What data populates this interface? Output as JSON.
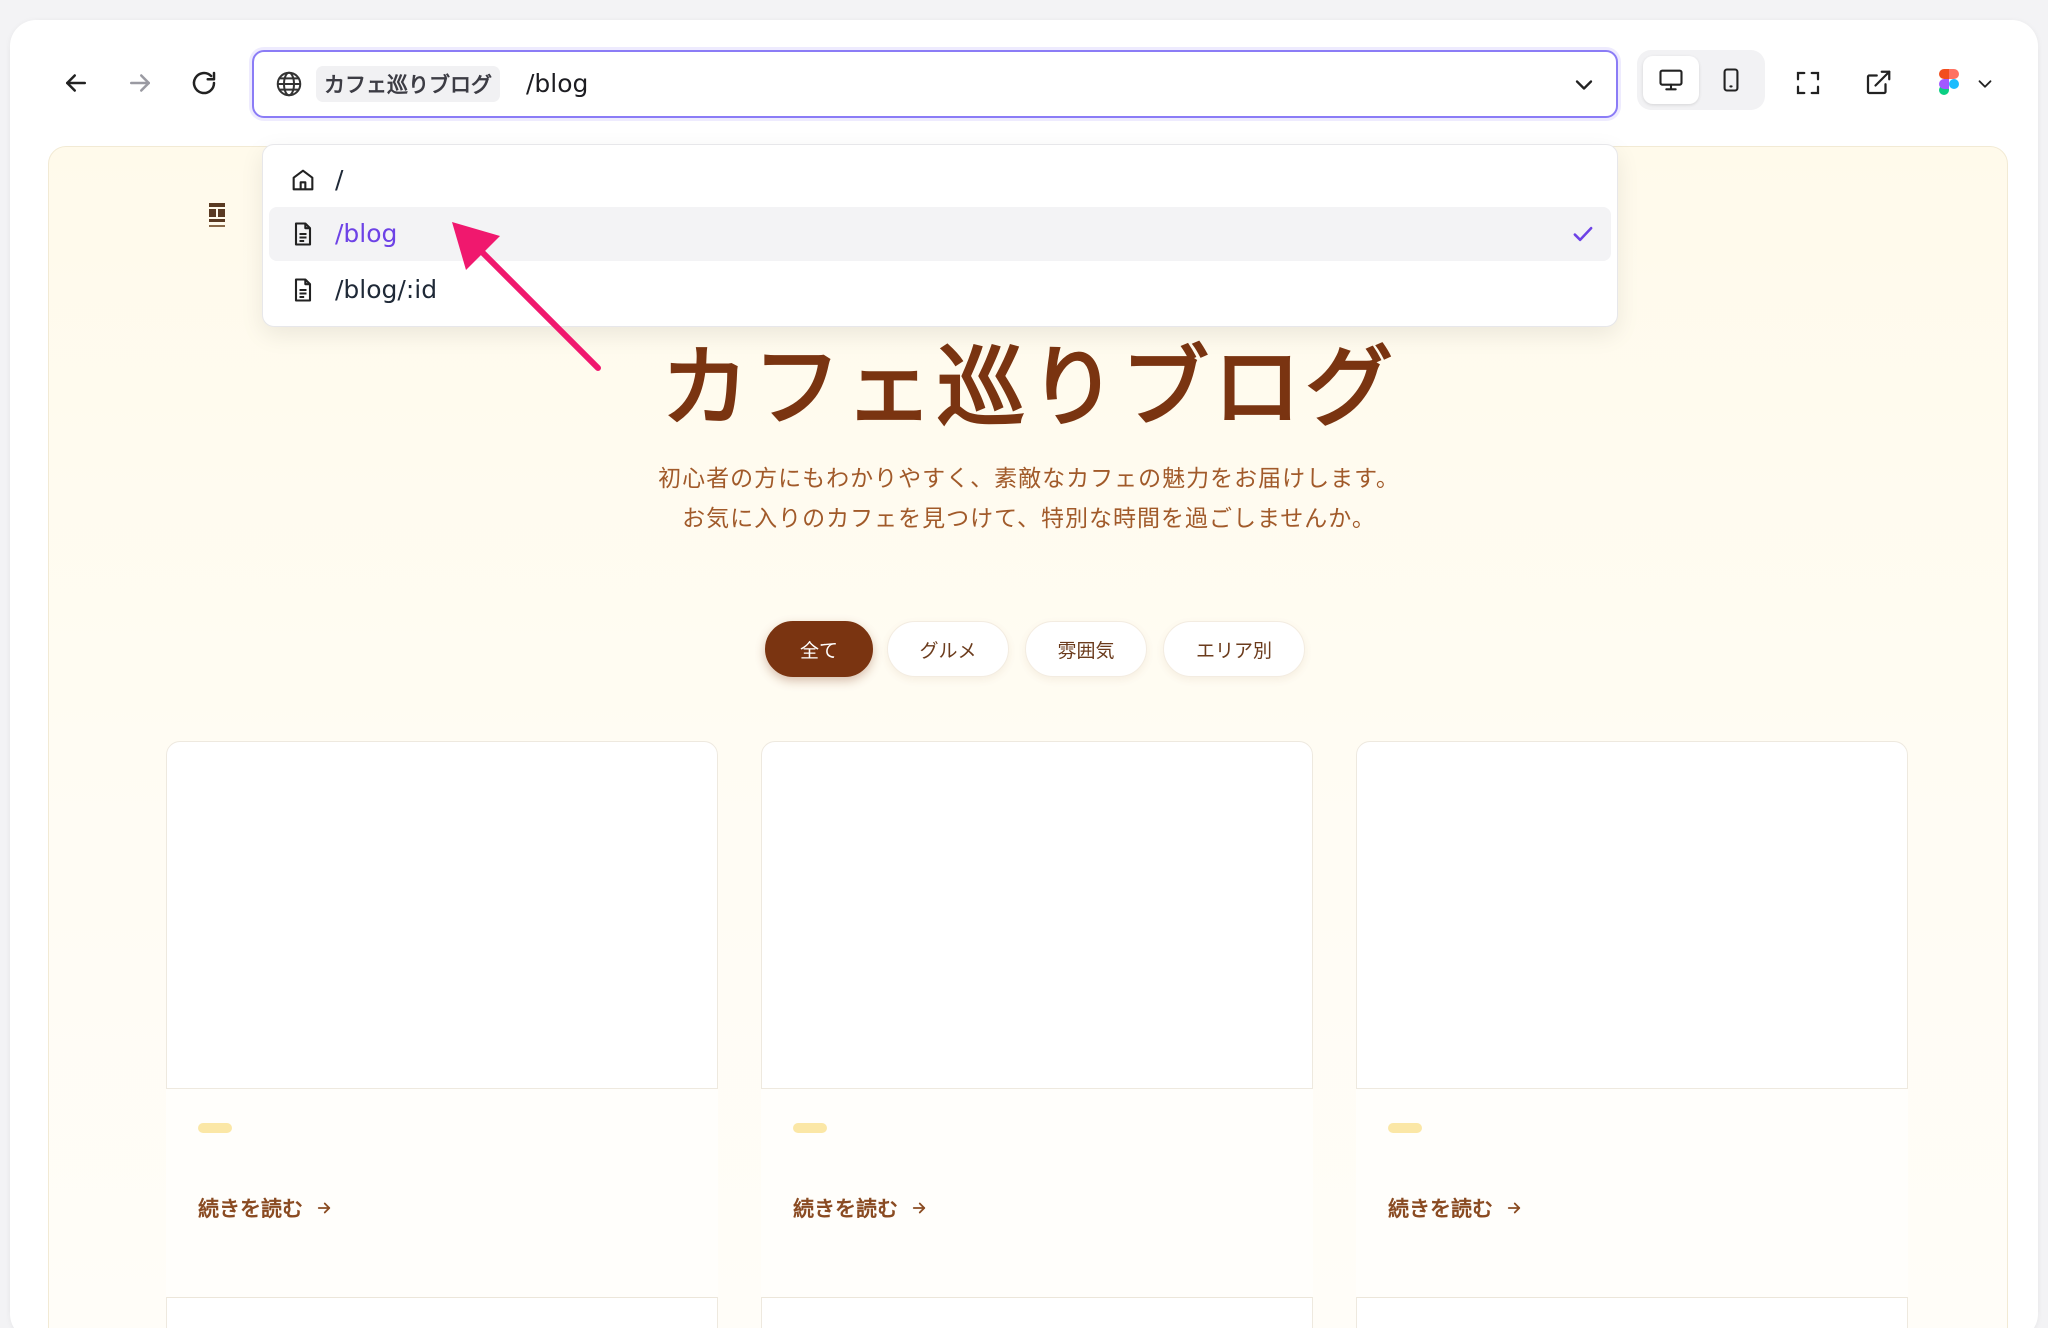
{
  "toolbar": {
    "site_name": "カフェ巡りブログ",
    "current_path": "/blog"
  },
  "dropdown": {
    "items": [
      {
        "label": "/",
        "icon": "home-icon",
        "selected": false
      },
      {
        "label": "/blog",
        "icon": "file-icon",
        "selected": true
      },
      {
        "label": "/blog/:id",
        "icon": "file-icon",
        "selected": false
      }
    ]
  },
  "page": {
    "hero_title": "カフェ巡りブログ",
    "hero_sub_1": "初心者の方にもわかりやすく、素敵なカフェの魅力をお届けします。",
    "hero_sub_2": "お気に入りのカフェを見つけて、特別な時間を過ごしませんか。",
    "filters": [
      "全て",
      "グルメ",
      "雰囲気",
      "エリア別"
    ],
    "read_more": "続きを読む"
  },
  "colors": {
    "accent": "#8b7cf6",
    "selected_text": "#6d42e6",
    "brand_brown": "#7a3411",
    "annotation_arrow": "#f0186e"
  }
}
